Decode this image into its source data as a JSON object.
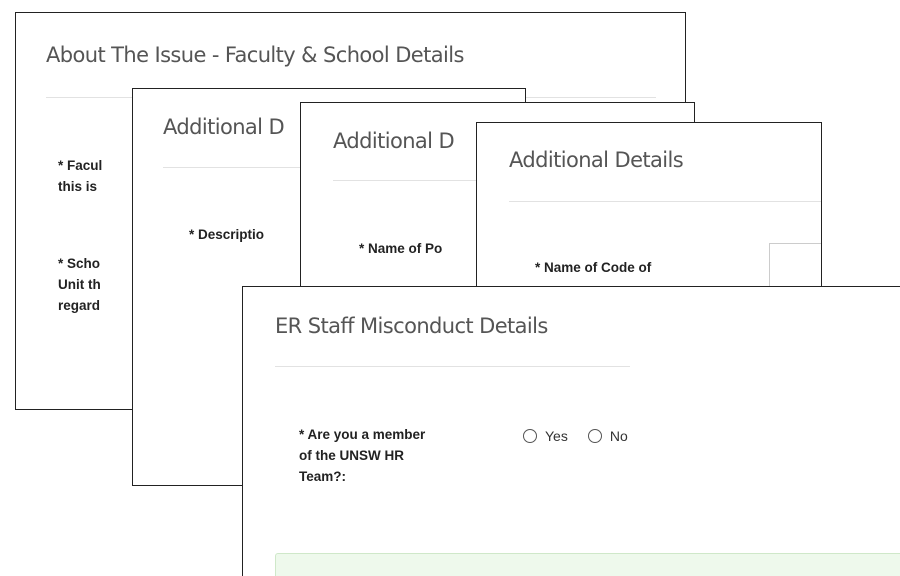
{
  "cards": {
    "faculty": {
      "title": "About The Issue - Faculty & School Details",
      "faculty_label": "* Facul\nthis is",
      "school_label": "* Scho\nUnit th\nregard"
    },
    "additional_1": {
      "title": "Additional D",
      "description_label": "* Descriptio"
    },
    "additional_2": {
      "title": "Additional D",
      "policy_label": "* Name of Po"
    },
    "additional_3": {
      "title": "Additional Details",
      "code_label": "* Name of Code of"
    },
    "misconduct": {
      "title": "ER Staff Misconduct Details",
      "hr_question": "* Are you a member\nof the UNSW HR\nTeam?:",
      "options": [
        "Yes",
        "No"
      ]
    }
  }
}
